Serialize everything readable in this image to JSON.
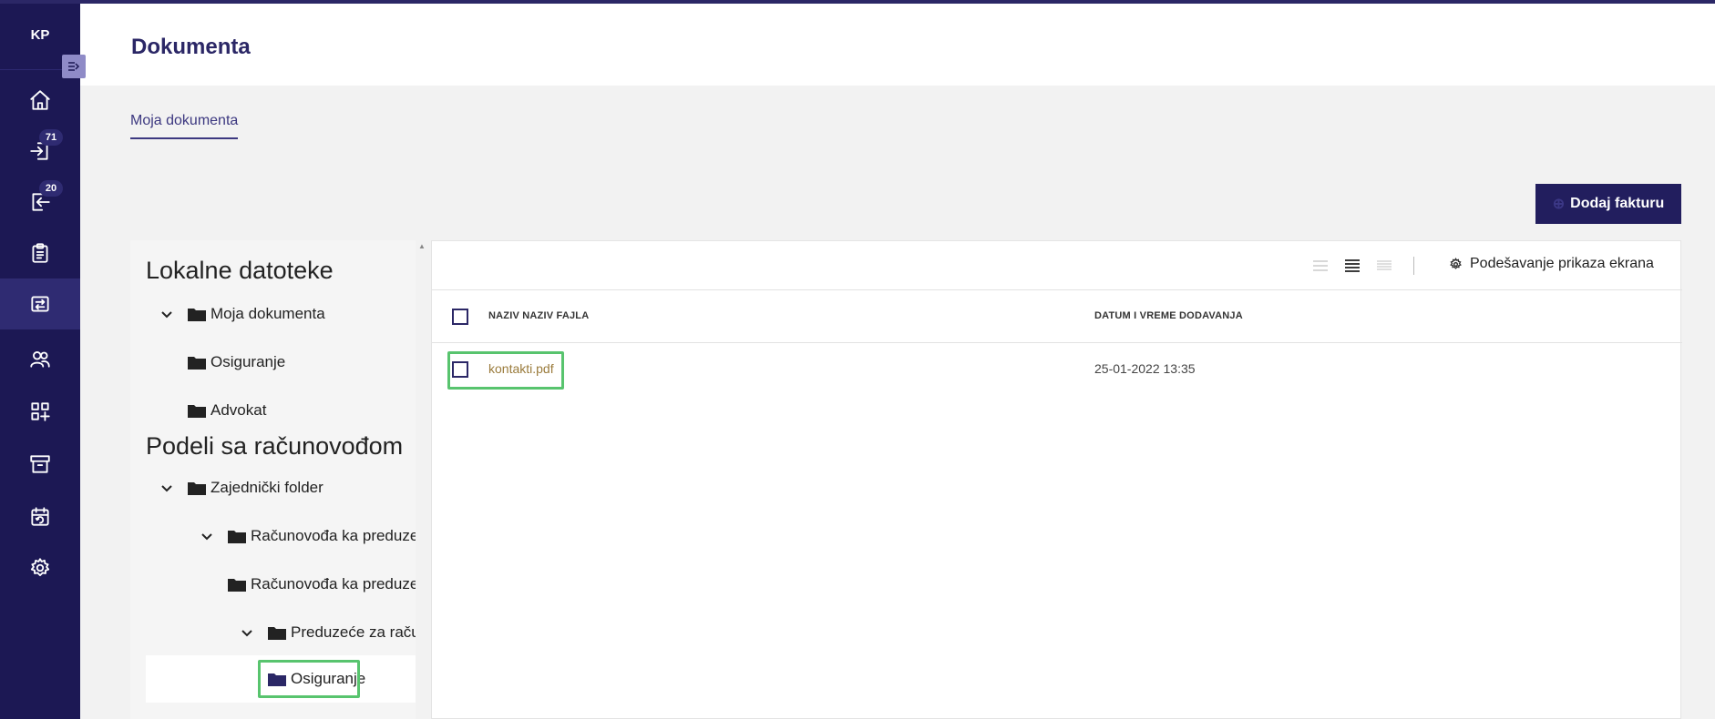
{
  "app": {
    "logo": "KP",
    "page_title": "Dokumenta"
  },
  "sidebar": {
    "items": [
      {
        "name": "home",
        "icon": "home-icon"
      },
      {
        "name": "incoming",
        "icon": "login-icon",
        "badge": "71"
      },
      {
        "name": "outgoing",
        "icon": "logout-icon",
        "badge": "20"
      },
      {
        "name": "clipboard",
        "icon": "clipboard-icon"
      },
      {
        "name": "documents",
        "icon": "transfer-icon",
        "active": true
      },
      {
        "name": "contacts",
        "icon": "users-icon"
      },
      {
        "name": "apps",
        "icon": "apps-add-icon"
      },
      {
        "name": "archive",
        "icon": "archive-icon"
      },
      {
        "name": "calendar",
        "icon": "calendar-sync-icon"
      },
      {
        "name": "settings",
        "icon": "gear-icon"
      }
    ]
  },
  "tabs": {
    "my_documents": "Moja dokumenta"
  },
  "actions": {
    "add_invoice": "Dodaj fakturu"
  },
  "tree": {
    "local_heading": "Lokalne datoteke",
    "local": {
      "root": "Moja dokumenta",
      "children": [
        "Osiguranje",
        "Advokat"
      ]
    },
    "shared_heading": "Podeli sa računovođom",
    "shared": {
      "root": "Zajednički folder",
      "level2a": "Računovođa ka preduzeću",
      "level2b": "Računovođa ka preduzeću",
      "level3": "Preduzeće za računovođu",
      "level4": "Osiguranje"
    }
  },
  "toolbar": {
    "settings_label": "Podešavanje prikaza ekrana"
  },
  "table": {
    "columns": {
      "name": "NAZIV NAZIV FAJLA",
      "date": "DATUM I VREME DODAVANJA"
    },
    "rows": [
      {
        "name": "kontakti.pdf",
        "date": "25-01-2022 13:35"
      }
    ]
  },
  "colors": {
    "sidebar": "#1c1854",
    "accent": "#2b2766",
    "highlight": "#58c46e"
  }
}
